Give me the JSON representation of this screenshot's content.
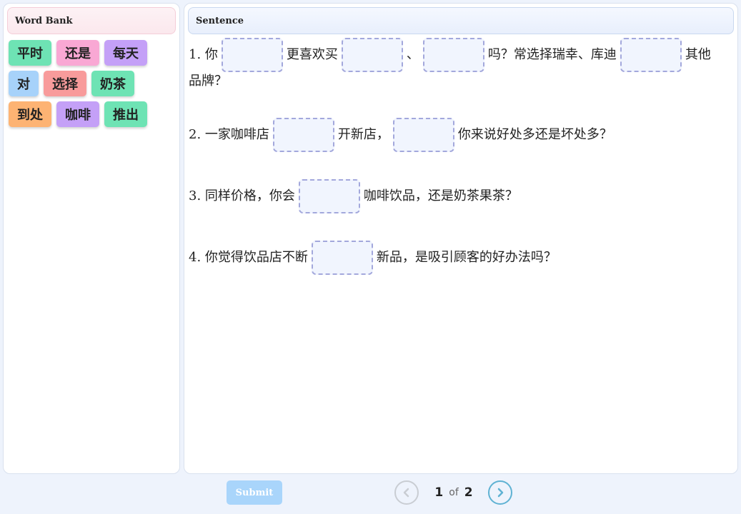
{
  "word_bank": {
    "title": "Word Bank",
    "words": [
      {
        "label": "平时",
        "color": "#6ee3b4"
      },
      {
        "label": "还是",
        "color": "#f9a8d4"
      },
      {
        "label": "每天",
        "color": "#c4a0f7"
      },
      {
        "label": "对",
        "color": "#a7d2fa"
      },
      {
        "label": "选择",
        "color": "#f89b9b"
      },
      {
        "label": "奶茶",
        "color": "#6ee3b4"
      },
      {
        "label": "到处",
        "color": "#fdb373"
      },
      {
        "label": "咖啡",
        "color": "#c4a0f7"
      },
      {
        "label": "推出",
        "color": "#6ee3b4"
      }
    ]
  },
  "sentence_panel": {
    "title": "Sentence",
    "sentences": [
      {
        "parts": [
          "1. 你",
          null,
          "更喜欢买",
          null,
          "、",
          null,
          "吗？常选择瑞幸、库迪",
          null,
          "其他",
          "品牌？"
        ]
      },
      {
        "parts": [
          "2. 一家咖啡店",
          null,
          "开新店，",
          null,
          "你来说好处多还是坏处多？"
        ]
      },
      {
        "parts": [
          "3. 同样价格，你会",
          null,
          "咖啡饮品，还是奶茶果茶？"
        ]
      },
      {
        "parts": [
          "4. 你觉得饮品店不断",
          null,
          "新品，是吸引顾客的好办法吗？"
        ]
      }
    ]
  },
  "footer": {
    "submit_label": "Submit",
    "page_current": "1",
    "page_of": "of",
    "page_total": "2"
  },
  "icons": {
    "prev": "chevron-left-icon",
    "next": "chevron-right-icon"
  }
}
